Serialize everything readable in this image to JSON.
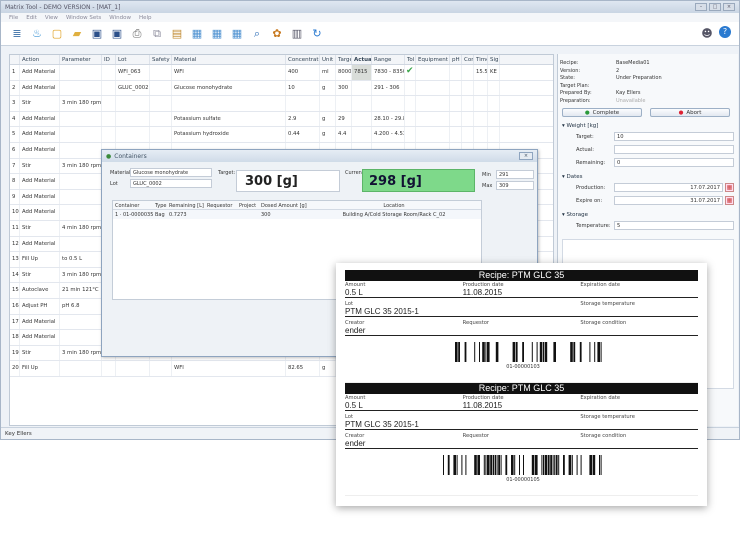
{
  "app": {
    "title": "Matrix Tool - DEMO VERSION - [MAT_1]",
    "menu": [
      "File",
      "Edit",
      "View",
      "Window Sets",
      "Window",
      "Help"
    ]
  },
  "table": {
    "headers": [
      "",
      "Action",
      "Parameter",
      "ID",
      "Lot",
      "Safety",
      "Material",
      "Concentration",
      "Unit",
      "Target",
      "Actual",
      "Range",
      "Tol",
      "Equipment",
      "pH",
      "Com",
      "Time",
      "Sign"
    ],
    "rows": [
      {
        "n": "1",
        "action": "Add Material",
        "param": "",
        "id": "",
        "lot": "WFI_063",
        "material": "WFI",
        "conc": "400",
        "unit": "ml",
        "target": "8000",
        "actual": "7815",
        "range": "7830 - 8350",
        "check": "✔",
        "time": "15.56",
        "sign": "KE"
      },
      {
        "n": "2",
        "action": "Add Material",
        "param": "",
        "id": "",
        "lot": "GLUC_0002",
        "material": "Glucose monohydrate",
        "conc": "10",
        "unit": "g",
        "target": "300",
        "actual": "",
        "range": "291 - 306",
        "check": "",
        "time": "",
        "sign": ""
      },
      {
        "n": "3",
        "action": "Stir",
        "param": "3 min 180 rpm",
        "id": "",
        "lot": "",
        "material": "",
        "conc": "",
        "unit": "",
        "target": "",
        "actual": "",
        "range": "",
        "check": "",
        "time": "",
        "sign": ""
      },
      {
        "n": "4",
        "action": "Add Material",
        "param": "",
        "id": "",
        "lot": "",
        "material": "Potassium sulfate",
        "conc": "2.9",
        "unit": "g",
        "target": "29",
        "actual": "",
        "range": "28.10 - 29.87",
        "check": "",
        "time": "",
        "sign": ""
      },
      {
        "n": "5",
        "action": "Add Material",
        "param": "",
        "id": "",
        "lot": "",
        "material": "Potassium hydroxide",
        "conc": "0.44",
        "unit": "g",
        "target": "4.4",
        "actual": "",
        "range": "4.200 - 4.530",
        "check": "",
        "time": "",
        "sign": ""
      },
      {
        "n": "6",
        "action": "Add Material",
        "param": "",
        "id": "",
        "lot": "",
        "material": "",
        "conc": "",
        "unit": "",
        "target": "",
        "actual": "",
        "range": "",
        "check": "",
        "time": "",
        "sign": ""
      },
      {
        "n": "7",
        "action": "Stir",
        "param": "3 min 180 rpm",
        "id": "",
        "lot": "",
        "material": "",
        "conc": "",
        "unit": "",
        "target": "",
        "actual": "",
        "range": "",
        "check": "",
        "time": "",
        "sign": ""
      },
      {
        "n": "8",
        "action": "Add Material",
        "param": "",
        "id": "",
        "lot": "",
        "material": "",
        "conc": "",
        "unit": "",
        "target": "",
        "actual": "",
        "range": "",
        "check": "",
        "time": "",
        "sign": ""
      },
      {
        "n": "9",
        "action": "Add Material",
        "param": "",
        "id": "",
        "lot": "",
        "material": "",
        "conc": "",
        "unit": "",
        "target": "",
        "actual": "",
        "range": "",
        "check": "",
        "time": "",
        "sign": ""
      },
      {
        "n": "10",
        "action": "Add Material",
        "param": "",
        "id": "",
        "lot": "",
        "material": "",
        "conc": "",
        "unit": "",
        "target": "",
        "actual": "",
        "range": "",
        "check": "",
        "time": "",
        "sign": ""
      },
      {
        "n": "11",
        "action": "Stir",
        "param": "4 min 180 rpm",
        "id": "",
        "lot": "",
        "material": "",
        "conc": "",
        "unit": "",
        "target": "",
        "actual": "",
        "range": "",
        "check": "",
        "time": "",
        "sign": ""
      },
      {
        "n": "12",
        "action": "Add Material",
        "param": "",
        "id": "",
        "lot": "",
        "material": "",
        "conc": "",
        "unit": "",
        "target": "",
        "actual": "",
        "range": "",
        "check": "",
        "time": "",
        "sign": ""
      },
      {
        "n": "13",
        "action": "Fill Up",
        "param": "to 0.5 L",
        "id": "",
        "lot": "",
        "material": "",
        "conc": "",
        "unit": "",
        "target": "",
        "actual": "",
        "range": "",
        "check": "",
        "time": "",
        "sign": ""
      },
      {
        "n": "14",
        "action": "Stir",
        "param": "3 min 180 rpm",
        "id": "",
        "lot": "",
        "material": "",
        "conc": "",
        "unit": "",
        "target": "",
        "actual": "",
        "range": "",
        "check": "",
        "time": "",
        "sign": ""
      },
      {
        "n": "15",
        "action": "Autoclave",
        "param": "21 min 121°C",
        "id": "",
        "lot": "",
        "material": "",
        "conc": "",
        "unit": "",
        "target": "",
        "actual": "",
        "range": "",
        "check": "",
        "time": "",
        "sign": ""
      },
      {
        "n": "16",
        "action": "Adjust PH",
        "param": "pH 6.8",
        "id": "",
        "lot": "",
        "material": "",
        "conc": "",
        "unit": "",
        "target": "",
        "actual": "",
        "range": "",
        "check": "",
        "time": "",
        "sign": ""
      },
      {
        "n": "17",
        "action": "Add Material",
        "param": "",
        "id": "",
        "lot": "",
        "material": "",
        "conc": "",
        "unit": "",
        "target": "",
        "actual": "",
        "range": "",
        "check": "",
        "time": "",
        "sign": ""
      },
      {
        "n": "18",
        "action": "Add Material",
        "param": "",
        "id": "",
        "lot": "",
        "material": "",
        "conc": "",
        "unit": "",
        "target": "",
        "actual": "",
        "range": "",
        "check": "",
        "time": "",
        "sign": ""
      },
      {
        "n": "19",
        "action": "Stir",
        "param": "3 min 180 rpm",
        "id": "",
        "lot": "",
        "material": "",
        "conc": "",
        "unit": "",
        "target": "",
        "actual": "",
        "range": "",
        "check": "",
        "time": "",
        "sign": ""
      },
      {
        "n": "20",
        "action": "Fill Up",
        "param": "",
        "id": "",
        "lot": "",
        "material": "WFI",
        "conc": "82.65",
        "unit": "g",
        "target": "",
        "actual": "",
        "range": "",
        "check": "",
        "time": "",
        "sign": ""
      }
    ]
  },
  "side": {
    "info": [
      [
        "Recipe:",
        "BaseMedia01"
      ],
      [
        "Version:",
        "2"
      ],
      [
        "State:",
        "Under Preparation"
      ],
      [
        "Target Plan:",
        ""
      ],
      [
        "Prepared By:",
        "Kay Ellers"
      ],
      [
        "Preparation:",
        "Unavailable"
      ]
    ],
    "complete": "Complete",
    "abort": "Abort",
    "weight_title": "Weight [kg]",
    "target_label": "Target:",
    "target_val": "10",
    "actual_label": "Actual:",
    "actual_val": "",
    "remaining_label": "Remaining:",
    "remaining_val": "0",
    "dates_title": "Dates",
    "production_label": "Production:",
    "production_val": "17.07.2017",
    "expire_label": "Expire on:",
    "expire_val": "31.07.2017",
    "storage_title": "Storage",
    "temperature_label": "Temperature:",
    "temperature_val": "5"
  },
  "status": "Key Ellers",
  "dialog": {
    "title": "Containers",
    "material_label": "Material",
    "material_val": "Glucose monohydrate",
    "lot_label": "Lot",
    "lot_val": "GLUC_0002",
    "target_label": "Target:",
    "target_val": "300 [g]",
    "current_label": "Current:",
    "current_val": "298 [g]",
    "min_label": "Min",
    "min_val": "291",
    "max_label": "Max",
    "max_val": "309",
    "cols": [
      "Container",
      "Type",
      "Remaining [L]",
      "Requestor",
      "Project",
      "Dosed Amount [g]",
      "Location"
    ],
    "row": [
      "1 · 01-00000351",
      "Bag",
      "0.7273",
      "",
      "",
      "300",
      "Building A/Cold Storage Room/Rack C_02"
    ]
  },
  "label": {
    "title": "Recipe: PTM GLC 35",
    "amount_cap": "Amount",
    "amount_val": "0.5 L",
    "prod_cap": "Production date",
    "prod_val": "11.08.2015",
    "exp_cap": "Expiration date",
    "lot_cap": "Lot",
    "lot_val": "PTM GLC 35 2015-1",
    "storage_cap": "Storage temperature",
    "creator_cap": "Creator",
    "creator_val": "ender",
    "requestor_cap": "Requestor",
    "cond_cap": "Storage condition",
    "barcode1": "01-00000103",
    "barcode2": "01-00000105"
  }
}
